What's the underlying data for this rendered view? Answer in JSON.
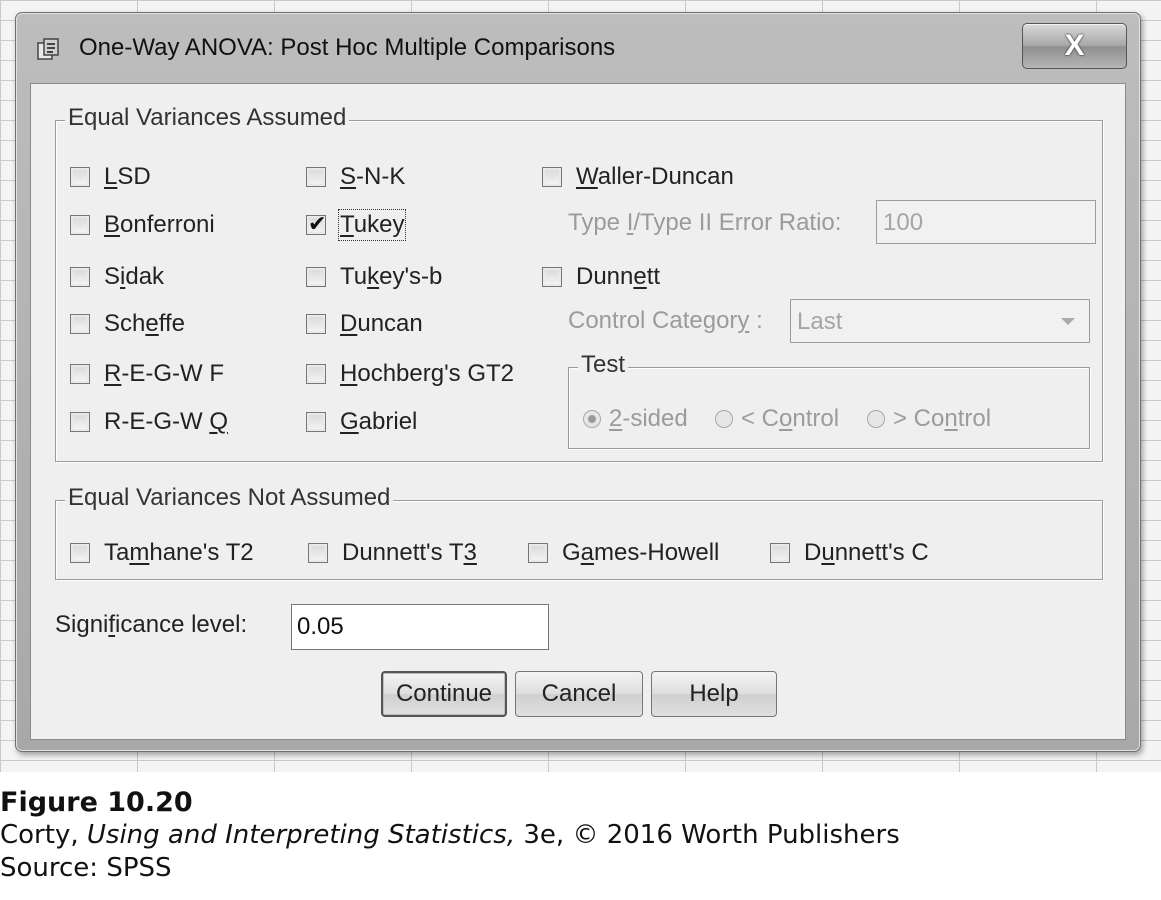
{
  "dialog": {
    "title": "One-Way ANOVA: Post Hoc Multiple Comparisons",
    "close_label": "X"
  },
  "equal_assumed": {
    "label": "Equal Variances Assumed",
    "col1": [
      {
        "label": "LSD",
        "checked": false
      },
      {
        "label": "Bonferroni",
        "checked": false
      },
      {
        "label": "Sidak",
        "checked": false
      },
      {
        "label": "Scheffe",
        "checked": false
      },
      {
        "label": "R-E-G-W F",
        "checked": false
      },
      {
        "label": "R-E-G-W Q",
        "checked": false
      }
    ],
    "col2": [
      {
        "label": "S-N-K",
        "checked": false
      },
      {
        "label": "Tukey",
        "checked": true
      },
      {
        "label": "Tukey's-b",
        "checked": false
      },
      {
        "label": "Duncan",
        "checked": false
      },
      {
        "label": "Hochberg's GT2",
        "checked": false
      },
      {
        "label": "Gabriel",
        "checked": false
      }
    ],
    "waller": {
      "label": "Waller-Duncan",
      "checked": false
    },
    "error_ratio": {
      "label": "Type I/Type II Error Ratio:",
      "value": "100"
    },
    "dunnett": {
      "label": "Dunnett",
      "checked": false
    },
    "control_category": {
      "label": "Control Category :",
      "value": "Last"
    },
    "test": {
      "label": "Test",
      "options": [
        "2-sided",
        "< Control",
        "> Control"
      ],
      "selected": "2-sided"
    }
  },
  "equal_not_assumed": {
    "label": "Equal Variances Not Assumed",
    "items": [
      {
        "label": "Tamhane's T2",
        "checked": false
      },
      {
        "label": "Dunnett's T3",
        "checked": false
      },
      {
        "label": "Games-Howell",
        "checked": false
      },
      {
        "label": "Dunnett's C",
        "checked": false
      }
    ]
  },
  "significance": {
    "label": "Significance level:",
    "value": "0.05"
  },
  "buttons": {
    "continue": "Continue",
    "cancel": "Cancel",
    "help": "Help"
  },
  "caption": {
    "figure": "Figure 10.20",
    "author": "Corty, ",
    "book": "Using and Interpreting Statistics,",
    "edition": " 3e, © 2016 Worth Publishers",
    "source": "Source: SPSS"
  }
}
